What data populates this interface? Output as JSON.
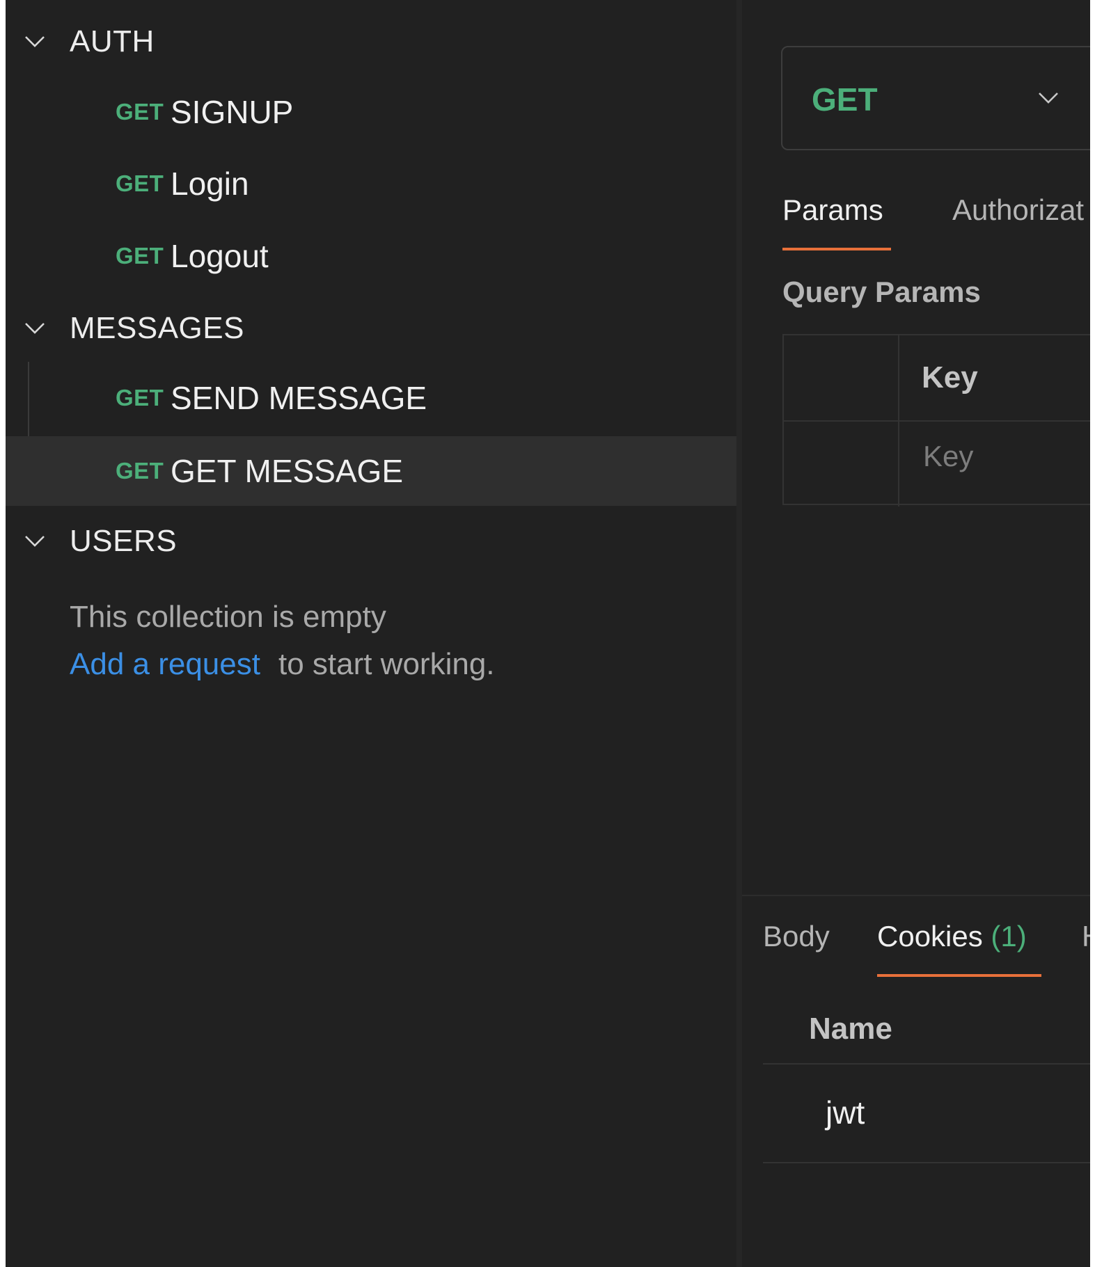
{
  "sidebar": {
    "folders": [
      {
        "label": "AUTH",
        "requests": [
          {
            "method": "GET",
            "name": "SIGNUP"
          },
          {
            "method": "GET",
            "name": "Login"
          },
          {
            "method": "GET",
            "name": "Logout"
          }
        ]
      },
      {
        "label": "MESSAGES",
        "requests": [
          {
            "method": "GET",
            "name": "SEND MESSAGE"
          },
          {
            "method": "GET",
            "name": "GET MESSAGE"
          }
        ]
      },
      {
        "label": "USERS",
        "empty_message": "This collection is empty",
        "add_link": "Add a request",
        "add_suffix": "to start working."
      }
    ],
    "active_request": "GET MESSAGE"
  },
  "request": {
    "method": "GET",
    "tabs": [
      "Params",
      "Authorizat"
    ],
    "active_tab": "Params",
    "query_params_title": "Query Params",
    "table": {
      "key_header": "Key",
      "key_placeholder": "Key"
    }
  },
  "response": {
    "tabs": {
      "body": "Body",
      "cookies": "Cookies",
      "cookies_count": "(1)",
      "headers_partial": "H"
    },
    "active_tab": "Cookies",
    "cookies": {
      "name_header": "Name",
      "rows": [
        "jwt"
      ]
    }
  },
  "colors": {
    "background": "#212121",
    "method_get": "#4caf7a",
    "tab_underline": "#e8703a",
    "link": "#3b8fe5",
    "active_row": "#2f2f2f"
  }
}
